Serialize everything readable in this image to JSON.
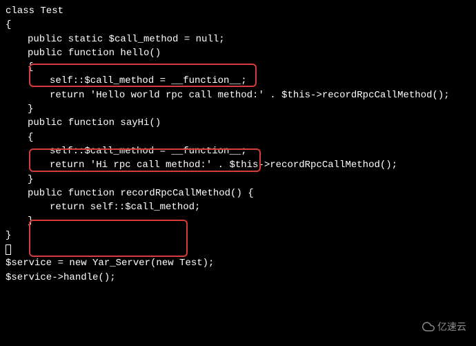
{
  "code": {
    "l0": "class Test",
    "l1": "{",
    "l2": "public static $call_method = null;",
    "l3": "public function hello()",
    "l4": "{",
    "l5": "self::$call_method = __function__;",
    "l6": "return 'Hello world rpc call method:' . $this->recordRpcCallMethod();",
    "l7": "}",
    "l8": "",
    "l9": "public function sayHi()",
    "l10": "{",
    "l11": "self::$call_method = __function__;",
    "l12": "return 'Hi rpc call method:' . $this->recordRpcCallMethod();",
    "l13": "}",
    "l14": "",
    "l15": "public function recordRpcCallMethod() {",
    "l16": "return self::$call_method;",
    "l17": "}",
    "l18": "",
    "l19": "}",
    "l20": "",
    "l21": "$service = new Yar_Server(new Test);",
    "l22": "$service->handle();"
  },
  "watermark": {
    "text": "亿速云"
  }
}
